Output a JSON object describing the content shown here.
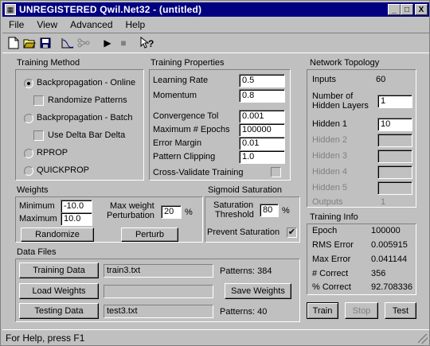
{
  "window": {
    "title": "UNREGISTERED  Qwil.Net32 - (untitled)",
    "controls": {
      "minimize": "_",
      "maximize": "□",
      "close": "X"
    }
  },
  "menu": [
    "File",
    "View",
    "Advanced",
    "Help"
  ],
  "toolbar": {
    "new": "new-icon",
    "open": "open-icon",
    "save": "save-icon",
    "chart": "chart-icon",
    "network": "network-icon",
    "run": "▶",
    "stop": "■",
    "help": "help-icon"
  },
  "training_method": {
    "title": "Training Method",
    "options": [
      "Backpropagation - Online",
      "Randomize Patterns",
      "Backpropagation - Batch",
      "Use Delta Bar Delta",
      "RPROP",
      "QUICKPROP"
    ],
    "selected": 0
  },
  "training_properties": {
    "title": "Training Properties",
    "learning_rate_label": "Learning Rate",
    "learning_rate": "0.5",
    "momentum_label": "Momentum",
    "momentum": "0.8",
    "convergence_tol_label": "Convergence Tol",
    "convergence_tol": "0.001",
    "max_epochs_label": "Maximum # Epochs",
    "max_epochs": "100000",
    "error_margin_label": "Error Margin",
    "error_margin": "0.01",
    "pattern_clipping_label": "Pattern Clipping",
    "pattern_clipping": "1.0",
    "cross_validate_label": "Cross-Validate Training"
  },
  "network_topology": {
    "title": "Network Topology",
    "inputs_label": "Inputs",
    "inputs": "60",
    "hidden_layers_label_1": "Number of",
    "hidden_layers_label_2": "Hidden Layers",
    "hidden_layers": "1",
    "hidden1_label": "Hidden 1",
    "hidden1": "10",
    "hidden2_label": "Hidden 2",
    "hidden3_label": "Hidden 3",
    "hidden4_label": "Hidden 4",
    "hidden5_label": "Hidden 5",
    "outputs_label": "Outputs",
    "outputs": "1"
  },
  "weights": {
    "title": "Weights",
    "minimum_label": "Minimum",
    "minimum": "-10.0",
    "maximum_label": "Maximum",
    "maximum": "10.0",
    "randomize_button": "Randomize",
    "max_perturb_label_1": "Max weight",
    "max_perturb_label_2": "Perturbation",
    "max_perturb": "20",
    "max_perturb_unit": "%",
    "perturb_button": "Perturb"
  },
  "sigmoid": {
    "title": "Sigmoid Saturation",
    "threshold_label_1": "Saturation",
    "threshold_label_2": "Threshold",
    "threshold": "80",
    "threshold_unit": "%",
    "prevent_label": "Prevent Saturation",
    "prevent_check": "✔"
  },
  "data_files": {
    "title": "Data Files",
    "training_button": "Training Data",
    "training_file": "train3.txt",
    "training_patterns": "Patterns: 384",
    "load_weights_button": "Load Weights",
    "save_weights_button": "Save Weights",
    "testing_button": "Testing Data",
    "testing_file": "test3.txt",
    "testing_patterns": "Patterns: 40"
  },
  "training_info": {
    "title": "Training Info",
    "epoch_label": "Epoch",
    "epoch": "100000",
    "rms_label": "RMS Error",
    "rms": "0.005915",
    "max_error_label": "Max Error",
    "max_error": "0.041144",
    "correct_label": "# Correct",
    "correct": "356",
    "pct_correct_label": "% Correct",
    "pct_correct": "92.708336",
    "train_button": "Train",
    "stop_button": "Stop",
    "test_button": "Test"
  },
  "status": {
    "text": "For Help, press F1"
  }
}
